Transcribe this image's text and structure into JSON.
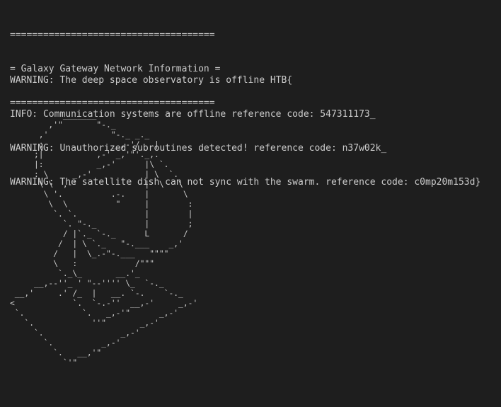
{
  "header": {
    "rule_top": "=====================================",
    "title": "= Galaxy Gateway Network Information =",
    "rule_bottom": "====================================="
  },
  "log": [
    "WARNING: The deep space observatory is offline HTB{",
    "INFO: Communication systems are offline reference code: 547311173_",
    "WARNING: Unauthorized subroutines detected! reference code: n37w02k_",
    "WARNING: The satellite dish can not sync with the swarm. reference code: c0mp20m153d}"
  ],
  "ascii_art": "           _______\n        ,'\"       \"-._\n      ,'             \"-._ _._\n      ;              __,-'/   |\n     ;|           ,-' _,'\"'._,.\n     |:           _,-'      |\\ `.\n     : \\     _,-'           | \\  `.\n      \\ \\  ,-'              |  \\   \\\n       \\ '.          .-.    |       \\\n        \\  \\          \"     |        :\n         `. `.              |        |\n           `. \"-._          |        ;\n           / |`._ `-._      L       /\n          /  | \\ `._   \"-.___    _,'\n         /   |  \\_.-\"-.___   \"\"\"\"\n         \\   :            /\"\"\"\n          `._\\_       __.'_\n     __,--''_ ' \"--'''' \\_  `-._\n __,'     .' /_  |   __. `-.    `-._\n<            `.  `-.-''  __,-'     _,-'\n `.            `.   _,-'\"      _,-'\n   `.            ''\"       _,-'\n     `.                _,-'\n       `.          _,-'\n         `.   __,'\"\n           `'\""
}
